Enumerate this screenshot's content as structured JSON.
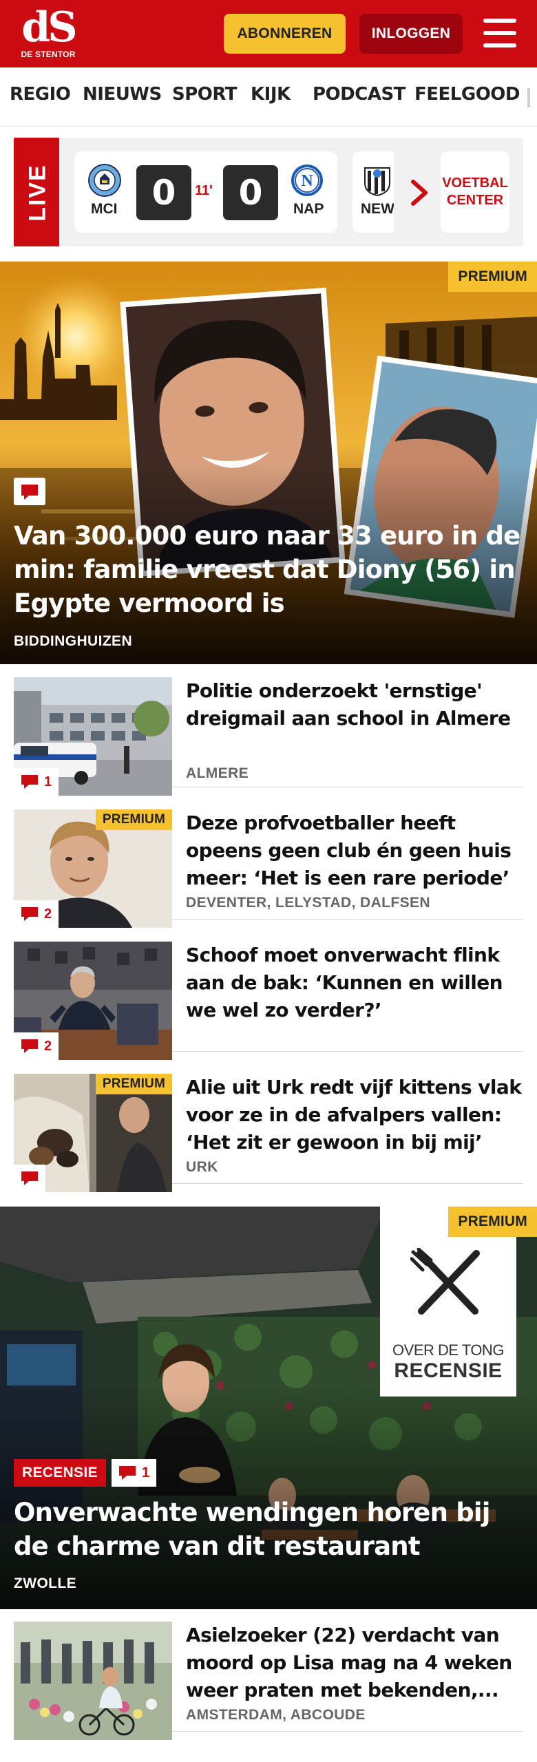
{
  "header": {
    "logo_mark": "dS",
    "logo_name": "DE STENTOR",
    "subscribe_label": "ABONNEREN",
    "login_label": "INLOGGEN"
  },
  "nav": {
    "items": [
      "REGIO",
      "NIEUWS",
      "SPORT",
      "KIJK",
      "PODCAST",
      "FEELGOOD"
    ]
  },
  "live": {
    "label": "LIVE",
    "match": {
      "home": "MCI",
      "away": "NAP",
      "home_score": "0",
      "away_score": "0",
      "minute": "11'"
    },
    "next_match_home": "NEW",
    "voetbal_center": "VOETBAL CENTER"
  },
  "hero": {
    "premium": "PREMIUM",
    "title": "Van 300.000 euro naar 33 euro in de min: familie vreest dat Diony (56) in Egypte vermoord is",
    "location": "BIDDINGHUIZEN"
  },
  "articles": [
    {
      "title": "Politie onderzoekt 'ernstige' dreigmail aan school in Almere",
      "location": "ALMERE",
      "comments": "1",
      "premium": ""
    },
    {
      "title": "Deze profvoetballer heeft opeens geen club én geen huis meer: ‘Het is een rare periode’",
      "location": "DEVENTER, LELYSTAD, DALFSEN",
      "comments": "2",
      "premium": "PREMIUM"
    },
    {
      "title": "Schoof moet onverwacht flink aan de bak: ‘Kunnen en willen we wel zo verder?’",
      "location": "",
      "comments": "2",
      "premium": ""
    },
    {
      "title": "Alie uit Urk redt vijf kittens vlak voor ze in de afvalpers vallen: ‘Het zit er gewoon in bij mij’",
      "location": "URK",
      "comments": "",
      "premium": "PREMIUM"
    },
    {
      "title": "Asielzoeker (22) verdacht van moord op Lisa mag na 4 weken weer praten met bekenden,...",
      "location": "AMSTERDAM, ABCOUDE",
      "comments": "",
      "premium": ""
    }
  ],
  "feature": {
    "premium": "PREMIUM",
    "card_top": "OVER DE TONG",
    "card_bottom": "RECENSIE",
    "badge": "RECENSIE",
    "comments": "1",
    "title": "Onverwachte wendingen horen bij de charme van dit restaurant",
    "location": "ZWOLLE"
  },
  "colors": {
    "brand_red": "#cc0a12",
    "premium_yellow": "#f6c12e",
    "login_dark_red": "#9c0510"
  },
  "icons": [
    "hamburger-menu-icon",
    "comment-icon",
    "chevron-right-icon",
    "club-crest-icon",
    "knife-fork-icon"
  ]
}
